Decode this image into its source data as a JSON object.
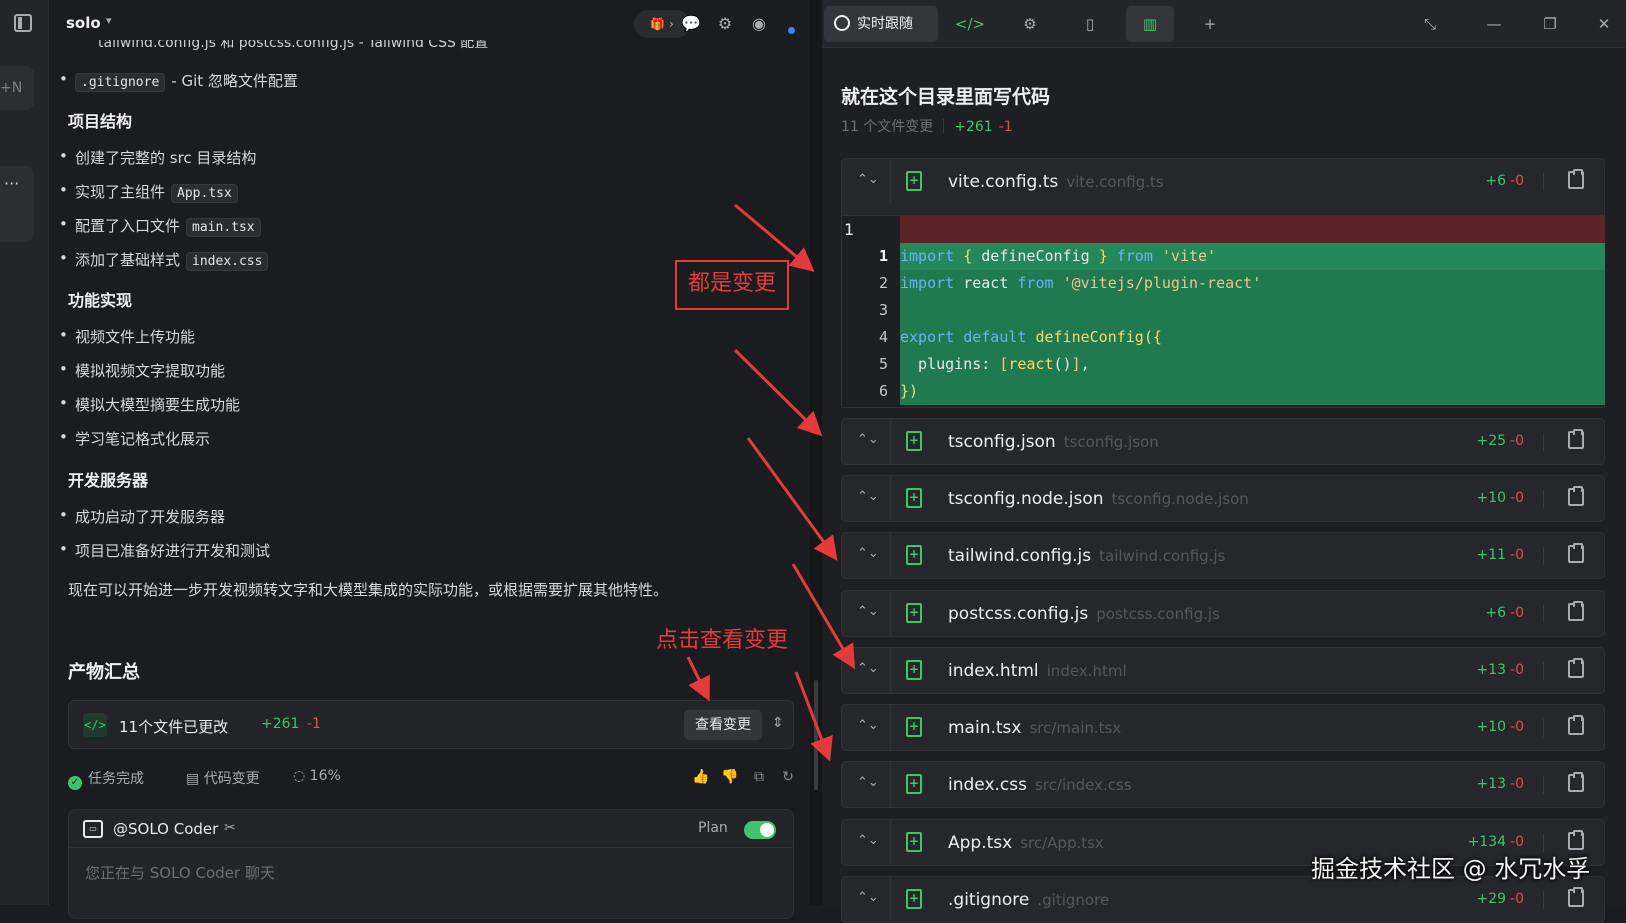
{
  "rail": {
    "new_label": "+N",
    "more_label": "···"
  },
  "chat": {
    "project_name": "solo",
    "cut_line": "tailwind.config.js 和 postcss.config.js - Tailwind CSS 配置",
    "gitignore_item": {
      "chip": ".gitignore",
      "text": "- Git 忽略文件配置"
    },
    "sections": [
      {
        "title": "项目结构",
        "items": [
          {
            "text": "创建了完整的 src 目录结构",
            "chip": ""
          },
          {
            "text": "实现了主组件",
            "chip": "App.tsx"
          },
          {
            "text": "配置了入口文件",
            "chip": "main.tsx"
          },
          {
            "text": "添加了基础样式",
            "chip": "index.css"
          }
        ]
      },
      {
        "title": "功能实现",
        "items": [
          {
            "text": "视频文件上传功能",
            "chip": ""
          },
          {
            "text": "模拟视频文字提取功能",
            "chip": ""
          },
          {
            "text": "模拟大模型摘要生成功能",
            "chip": ""
          },
          {
            "text": "学习笔记格式化展示",
            "chip": ""
          }
        ]
      },
      {
        "title": "开发服务器",
        "items": [
          {
            "text": "成功启动了开发服务器",
            "chip": ""
          },
          {
            "text": "项目已准备好进行开发和测试",
            "chip": ""
          }
        ]
      }
    ],
    "closing_paragraph": "现在可以开始进一步开发视频转文字和大模型集成的实际功能，或根据需要扩展其他特性。",
    "summary_title": "产物汇总",
    "changes_card": {
      "icon": "code-icon",
      "text": "11个文件已更改",
      "additions": "+261",
      "deletions": "-1",
      "view_button": "查看变更"
    },
    "status": {
      "done": "任务完成",
      "code_changes": "代码变更",
      "progress": "16%"
    },
    "composer": {
      "agent": "@SOLO Coder",
      "plan_label": "Plan",
      "plan_enabled": true,
      "placeholder": "您正在与 SOLO Coder 聊天"
    }
  },
  "annotations": {
    "all_changes": "都是变更",
    "click_to_view": "点击查看变更"
  },
  "right": {
    "follow_tab": "实时跟随",
    "diff_title": "就在这个目录里面写代码",
    "files_changed": "11 个文件变更",
    "total_add": "+261",
    "total_del": "-1",
    "files": [
      {
        "name": "vite.config.ts",
        "path": "vite.config.ts",
        "add": "+6",
        "del": "-0",
        "expanded": true
      },
      {
        "name": "tsconfig.json",
        "path": "tsconfig.json",
        "add": "+25",
        "del": "-0"
      },
      {
        "name": "tsconfig.node.json",
        "path": "tsconfig.node.json",
        "add": "+10",
        "del": "-0"
      },
      {
        "name": "tailwind.config.js",
        "path": "tailwind.config.js",
        "add": "+11",
        "del": "-0"
      },
      {
        "name": "postcss.config.js",
        "path": "postcss.config.js",
        "add": "+6",
        "del": "-0"
      },
      {
        "name": "index.html",
        "path": "index.html",
        "add": "+13",
        "del": "-0"
      },
      {
        "name": "main.tsx",
        "path": "src/main.tsx",
        "add": "+10",
        "del": "-0"
      },
      {
        "name": "index.css",
        "path": "src/index.css",
        "add": "+13",
        "del": "-0"
      },
      {
        "name": "App.tsx",
        "path": "src/App.tsx",
        "add": "+134",
        "del": "-0"
      },
      {
        "name": ".gitignore",
        "path": ".gitignore",
        "add": "+29",
        "del": "-0"
      }
    ],
    "code": {
      "old_line_number": "1",
      "lines": [
        {
          "n": "1",
          "html": "<span class=\"kw\">import</span> <span class=\"brk\">{</span> defineConfig <span class=\"brk\">}</span> <span class=\"kw\">from</span> <span class=\"str\">'vite'</span>"
        },
        {
          "n": "2",
          "html": "<span class=\"kw\">import</span> react <span class=\"kw\">from</span> <span class=\"str\">'@vitejs/plugin-react'</span>"
        },
        {
          "n": "3",
          "html": ""
        },
        {
          "n": "4",
          "html": "<span class=\"kw\">export default</span> <span class=\"fn\">defineConfig</span><span class=\"brk\">({</span>"
        },
        {
          "n": "5",
          "html": "  plugins: <span class=\"str\">[</span><span class=\"fn\">react</span>()<span class=\"str\">]</span>,"
        },
        {
          "n": "6",
          "html": "<span class=\"brk\">})</span>"
        }
      ]
    }
  },
  "watermark": "掘金技术社区 @ 水冗水孚"
}
